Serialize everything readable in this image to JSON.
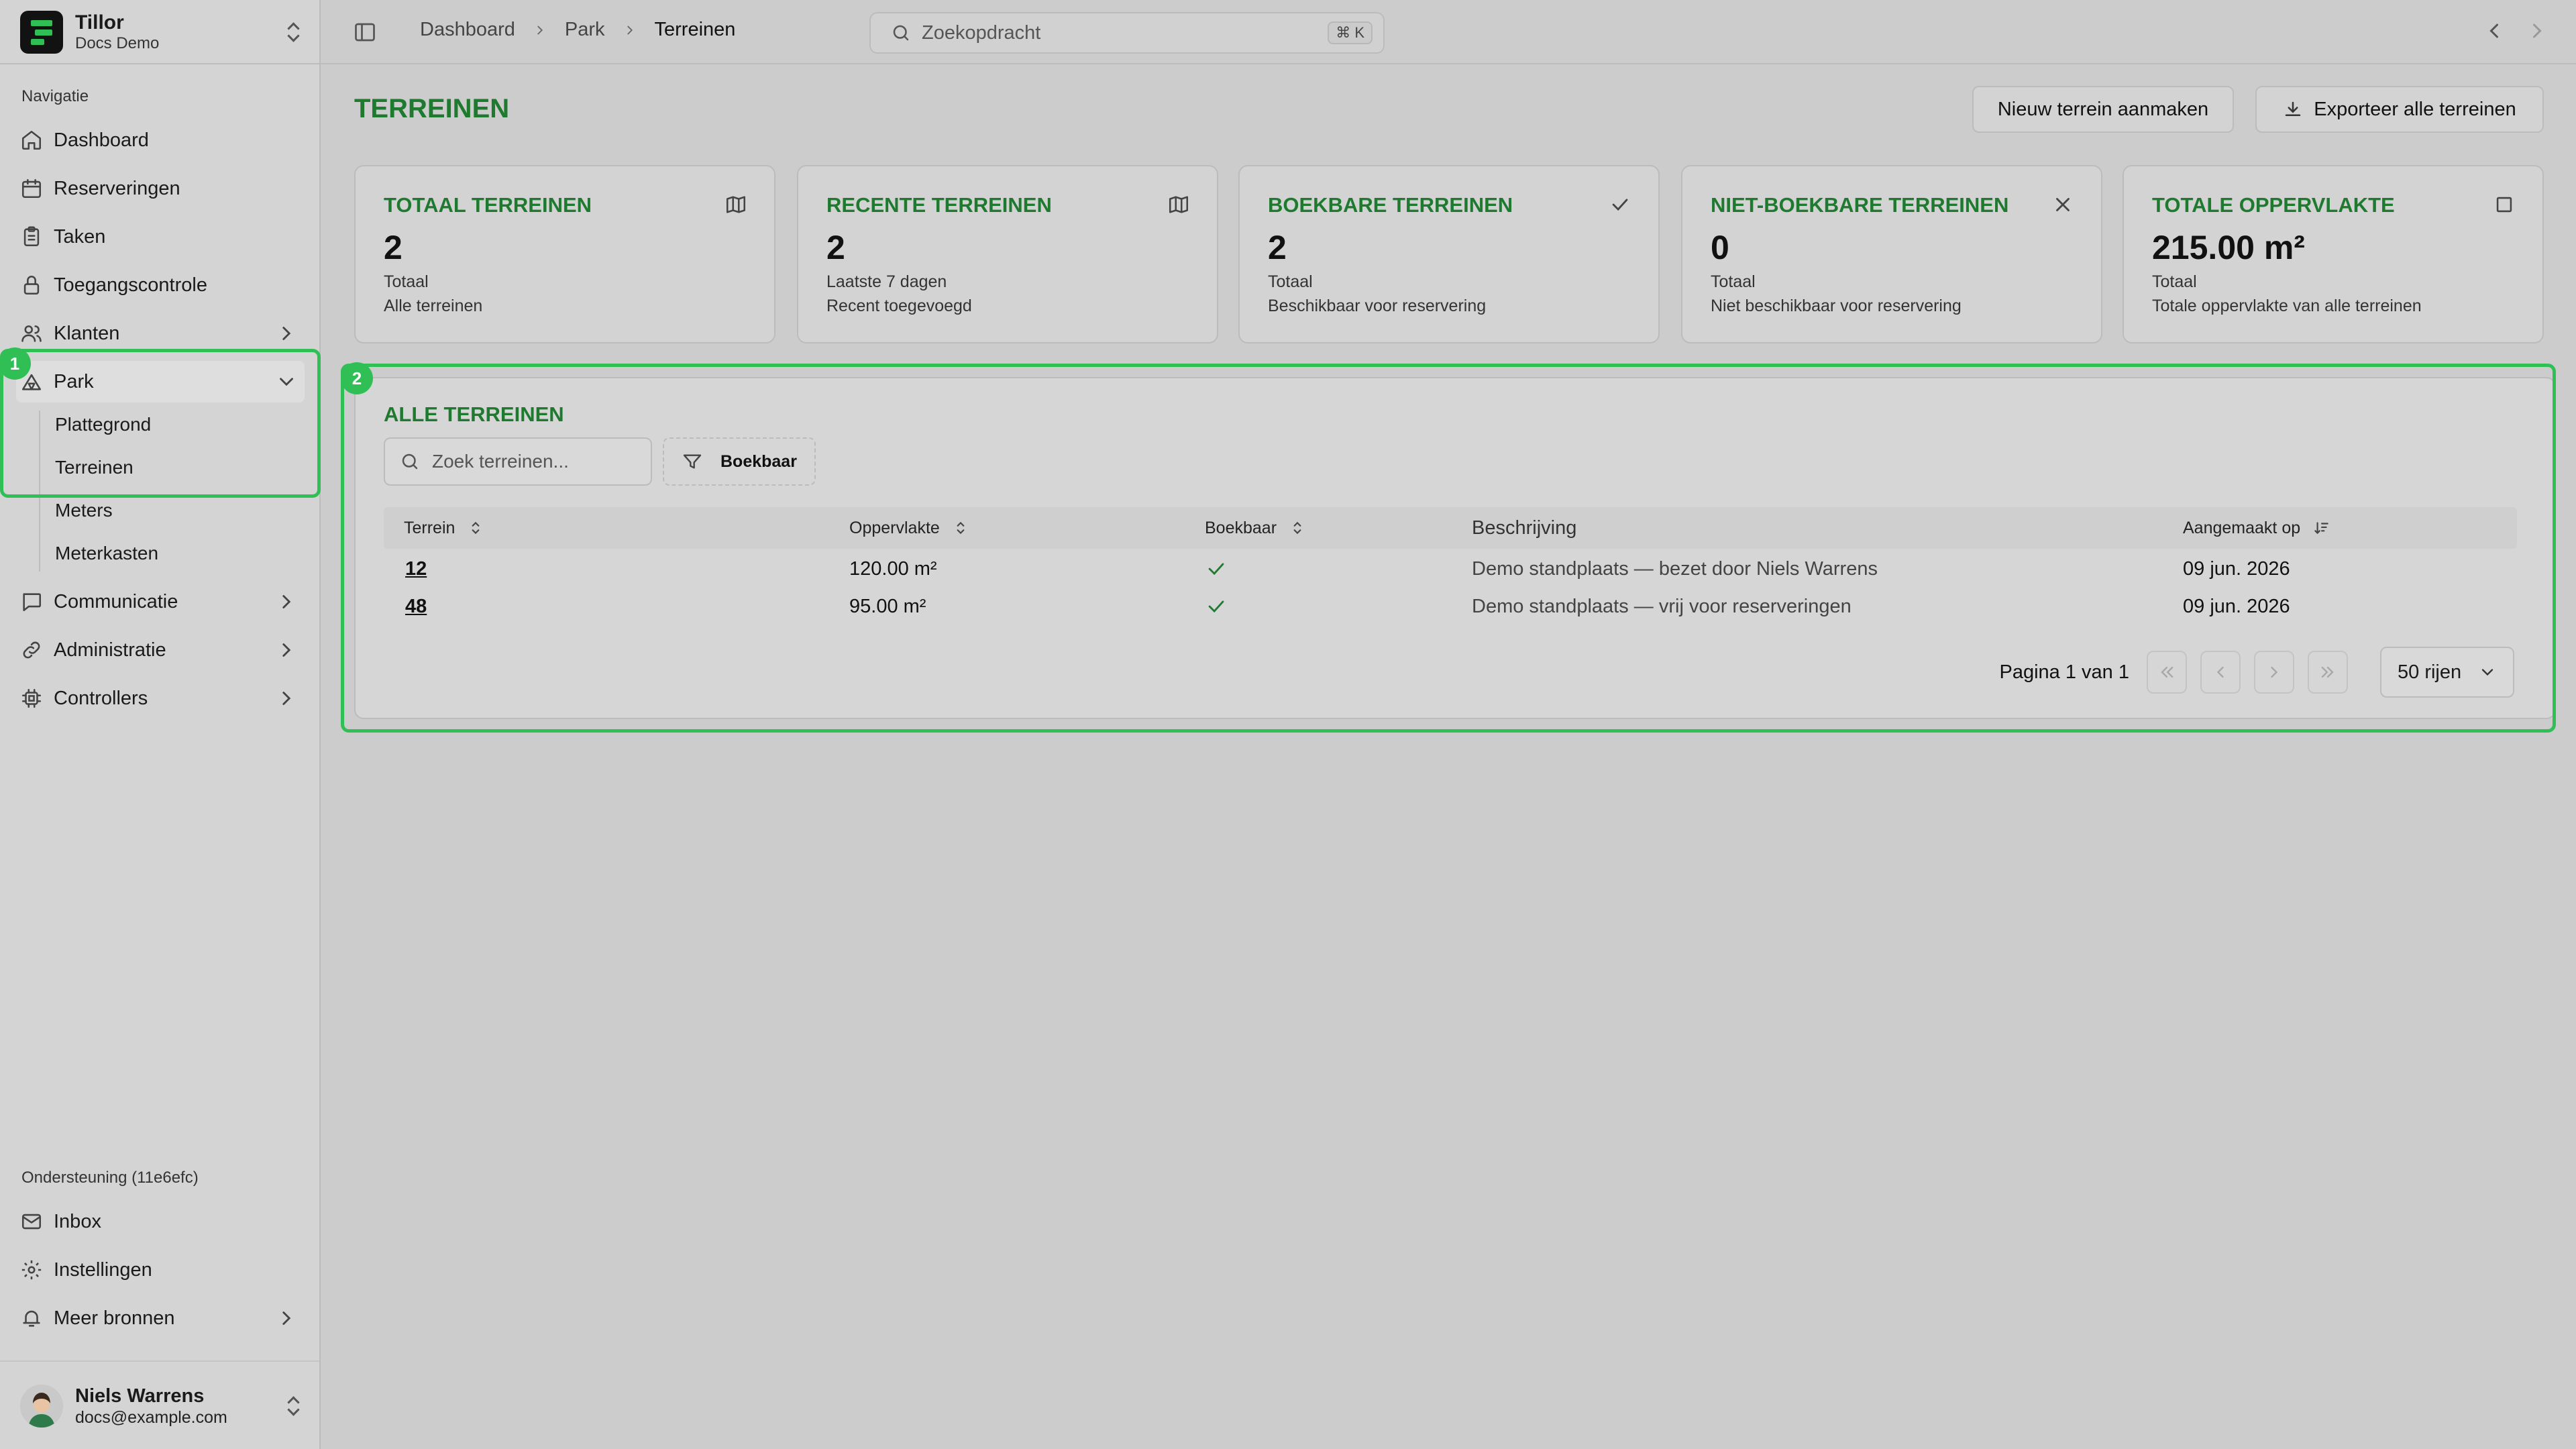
{
  "brand": {
    "title": "Tillor",
    "subtitle": "Docs Demo"
  },
  "sidebar": {
    "group_label": "Navigatie",
    "items": [
      {
        "label": "Dashboard",
        "icon": "home-icon"
      },
      {
        "label": "Reserveringen",
        "icon": "calendar-icon"
      },
      {
        "label": "Taken",
        "icon": "clipboard-icon"
      },
      {
        "label": "Toegangscontrole",
        "icon": "lock-icon"
      },
      {
        "label": "Klanten",
        "icon": "users-icon"
      },
      {
        "label": "Park",
        "icon": "tent-icon"
      },
      {
        "label": "Communicatie",
        "icon": "message-icon"
      },
      {
        "label": "Administratie",
        "icon": "link-icon"
      },
      {
        "label": "Controllers",
        "icon": "chip-icon"
      }
    ],
    "park_sub": [
      "Plattegrond",
      "Terreinen",
      "Meters",
      "Meterkasten"
    ],
    "support_label": "Ondersteuning (11e6efc)",
    "support_items": [
      {
        "label": "Inbox",
        "icon": "inbox-icon"
      },
      {
        "label": "Instellingen",
        "icon": "gear-icon"
      },
      {
        "label": "Meer bronnen",
        "icon": "bell-icon"
      }
    ]
  },
  "user": {
    "name": "Niels Warrens",
    "email": "docs@example.com"
  },
  "highlights": {
    "one": "1",
    "two": "2"
  },
  "breadcrumb": [
    "Dashboard",
    "Park",
    "Terreinen"
  ],
  "search": {
    "placeholder": "Zoekopdracht",
    "shortcut": "⌘ K"
  },
  "page": {
    "title": "TERREINEN",
    "new_button": "Nieuw terrein aanmaken",
    "export_button": "Exporteer alle terreinen"
  },
  "cards": [
    {
      "title": "TOTAAL TERREINEN",
      "value": "2",
      "line1": "Totaal",
      "line2": "Alle terreinen",
      "icon": "map-icon"
    },
    {
      "title": "RECENTE TERREINEN",
      "value": "2",
      "line1": "Laatste 7 dagen",
      "line2": "Recent toegevoegd",
      "icon": "map-icon"
    },
    {
      "title": "BOEKBARE TERREINEN",
      "value": "2",
      "line1": "Totaal",
      "line2": "Beschikbaar voor reservering",
      "icon": "check-icon"
    },
    {
      "title": "NIET-BOEKBARE TERREINEN",
      "value": "0",
      "line1": "Totaal",
      "line2": "Niet beschikbaar voor reservering",
      "icon": "close-icon"
    },
    {
      "title": "TOTALE OPPERVLAKTE",
      "value": "215.00 m²",
      "line1": "Totaal",
      "line2": "Totale oppervlakte van alle terreinen",
      "icon": "square-icon"
    }
  ],
  "table": {
    "title": "ALLE TERREINEN",
    "search_placeholder": "Zoek terreinen...",
    "filter_label": "Boekbaar",
    "columns": [
      "Terrein",
      "Oppervlakte",
      "Boekbaar",
      "Beschrijving",
      "Aangemaakt op"
    ],
    "rows": [
      {
        "terrein": "12",
        "oppervlakte": "120.00 m²",
        "boekbaar": true,
        "beschrijving": "Demo standplaats — bezet door Niels Warrens",
        "aangemaakt": "09 jun. 2026"
      },
      {
        "terrein": "48",
        "oppervlakte": "95.00 m²",
        "boekbaar": true,
        "beschrijving": "Demo standplaats — vrij voor reserveringen",
        "aangemaakt": "09 jun. 2026"
      }
    ],
    "pagination": {
      "text": "Pagina 1 van 1",
      "rows_per_page": "50 rijen"
    }
  },
  "colors": {
    "accent": "#1e7a2e",
    "highlight": "#2fbf55"
  }
}
